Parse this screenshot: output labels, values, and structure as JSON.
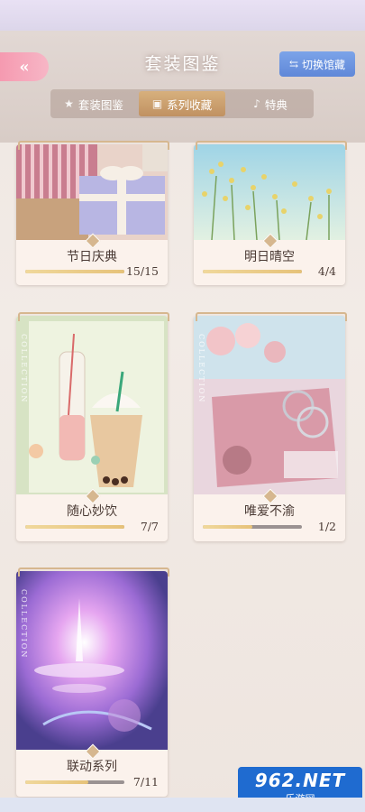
{
  "header": {
    "back_glyph": "«",
    "title": "套装图鉴",
    "switch_label": "切换馆藏",
    "switch_glyph": "⇆"
  },
  "tabs": [
    {
      "label": "套装图鉴",
      "icon": "star-icon",
      "active": false
    },
    {
      "label": "系列收藏",
      "icon": "box-icon",
      "active": true
    },
    {
      "label": "特典",
      "icon": "bell-icon",
      "active": false
    }
  ],
  "collection_word": "COLLECTION",
  "cards": [
    {
      "name": "节日庆典",
      "count": "15/15",
      "progress": 1.0
    },
    {
      "name": "明日晴空",
      "count": "4/4",
      "progress": 1.0
    },
    {
      "name": "随心妙饮",
      "count": "7/7",
      "progress": 1.0
    },
    {
      "name": "唯爱不渝",
      "count": "1/2",
      "progress": 0.5
    },
    {
      "name": "联动系列",
      "count": "7/11",
      "progress": 0.636
    }
  ],
  "watermark": {
    "line1": "962.NET",
    "line2": "乐游网"
  }
}
